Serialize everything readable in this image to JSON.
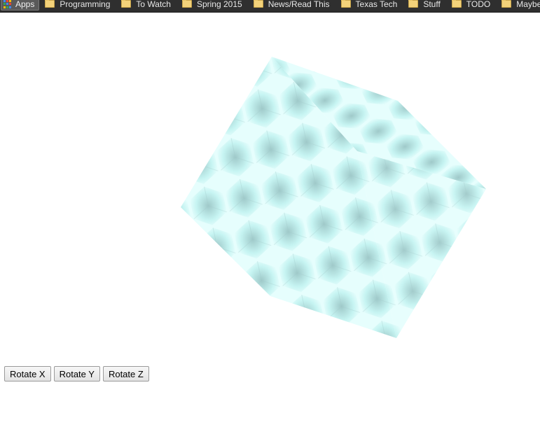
{
  "bookmarks_bar": {
    "apps_label": "Apps",
    "apps_icon": "apps-grid-icon",
    "folder_icon": "folder-icon",
    "items": [
      {
        "label": "Programming"
      },
      {
        "label": "To Watch"
      },
      {
        "label": "Spring 2015"
      },
      {
        "label": "News/Read This"
      },
      {
        "label": "Texas Tech"
      },
      {
        "label": "Stuff"
      },
      {
        "label": "TODO"
      },
      {
        "label": "Maybe buy th"
      }
    ]
  },
  "cube": {
    "face_color": "#c6f4f2",
    "shade_color": "#9fc9c9",
    "highlight_color": "#e6fefd"
  },
  "controls": {
    "rotate_x_label": "Rotate X",
    "rotate_y_label": "Rotate Y",
    "rotate_z_label": "Rotate Z"
  }
}
